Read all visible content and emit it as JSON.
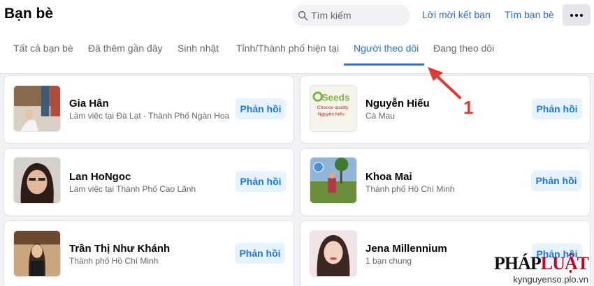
{
  "header": {
    "title": "Bạn bè",
    "search_placeholder": "Tìm kiếm",
    "friend_requests_link": "Lời mời kết bạn",
    "find_friends_link": "Tìm bạn bè",
    "more_icon": "more-dots-icon"
  },
  "tabs": [
    {
      "label": "Tất cả bạn bè"
    },
    {
      "label": "Đã thêm gần đây"
    },
    {
      "label": "Sinh nhật"
    },
    {
      "label": "Tỉnh/Thành phố hiện tại"
    },
    {
      "label": "Người theo dõi",
      "active": true
    },
    {
      "label": "Đang theo dõi"
    }
  ],
  "followers": [
    {
      "name": "Gia Hân",
      "subtitle": "Làm việc tại Đà Lạt - Thành Phố Ngàn Hoa",
      "action": "Phản hồi"
    },
    {
      "name": "Nguyễn Hiếu",
      "subtitle": "Cà Mau",
      "action": "Phản hồi",
      "avatar_text": "Seeds",
      "avatar_sub1": "Choose quality",
      "avatar_sub2": "Nguyễn hiếu"
    },
    {
      "name": "Lan HoNgoc",
      "subtitle": "Làm việc tại Thành Phố Cao Lãnh",
      "action": "Phản hồi"
    },
    {
      "name": "Khoa Mai",
      "subtitle": "Thành phố Hồ Chí Minh",
      "action": "Phản hồi"
    },
    {
      "name": "Trần Thị Như Khánh",
      "subtitle": "Thành phố Hồ Chí Minh",
      "action": "Phản hồi"
    },
    {
      "name": "Jena Millennium",
      "subtitle": "1 bạn chung",
      "action": "Phản hồi"
    }
  ],
  "annotation": {
    "number": "1",
    "color": "#e8372c"
  },
  "watermark": {
    "logo_part1": "PHÁP",
    "logo_part2": "LUẬT",
    "url": "kynguyenso.plo.vn"
  },
  "colors": {
    "accent": "#1877f2",
    "link": "#216fdb",
    "button_bg": "#e7f3ff"
  }
}
